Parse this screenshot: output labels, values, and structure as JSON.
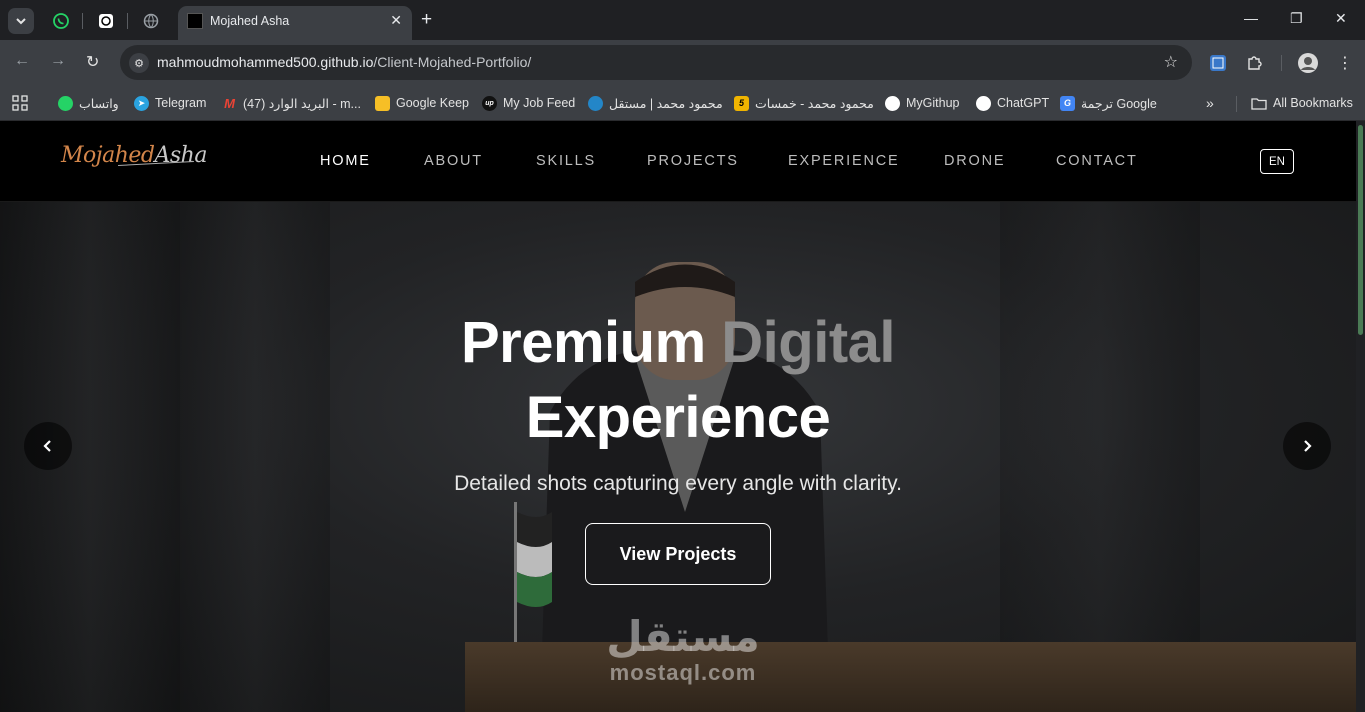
{
  "browser": {
    "tab": {
      "title": "Mojahed Asha",
      "close": "✕"
    },
    "new_tab": "+",
    "window": {
      "minimize": "—",
      "restore": "❐",
      "close": "✕"
    },
    "address": {
      "host": "mahmoudmohammed500.github.io",
      "path": "/Client-Mojahed-Portfolio/"
    },
    "bookmarks": [
      {
        "label": "واتساب",
        "icon": "whatsapp-icon",
        "color": "#25d366"
      },
      {
        "label": "Telegram",
        "icon": "telegram-icon",
        "color": "#2aa3e0"
      },
      {
        "label": "البريد الوارد (47) - m...",
        "icon": "gmail-icon",
        "color": "#ea4335"
      },
      {
        "label": "Google Keep",
        "icon": "keep-icon",
        "color": "#f6bf26"
      },
      {
        "label": "My Job Feed",
        "icon": "upwork-icon",
        "color": "#111111"
      },
      {
        "label": "محمود محمد | مستقل",
        "icon": "mostaql-icon",
        "color": "#2386c8"
      },
      {
        "label": "محمود محمد - خمسات",
        "icon": "khamsat-icon",
        "color": "#f0b400"
      },
      {
        "label": "MyGithup",
        "icon": "github-icon",
        "color": "#ffffff"
      },
      {
        "label": "ChatGPT",
        "icon": "chatgpt-icon",
        "color": "#ffffff"
      },
      {
        "label": "ترجمة Google",
        "icon": "translate-icon",
        "color": "#4285f4"
      }
    ],
    "overflow": "»",
    "all_bookmarks": "All Bookmarks"
  },
  "site": {
    "logo": {
      "first": "Mojahed",
      "second": "Asha"
    },
    "nav": [
      "HOME",
      "ABOUT",
      "SKILLS",
      "PROJECTS",
      "EXPERIENCE",
      "DRONE",
      "CONTACT"
    ],
    "active_nav": "HOME",
    "lang": "EN",
    "hero": {
      "title_word1": "Premium",
      "title_word2": "Digital",
      "title_line2": "Experience",
      "subtitle": "Detailed shots capturing every angle with clarity.",
      "cta": "View Projects",
      "prev": "‹",
      "next": "›"
    },
    "watermark": {
      "arabic": "مستقل",
      "latin": "mostaql.com"
    }
  }
}
